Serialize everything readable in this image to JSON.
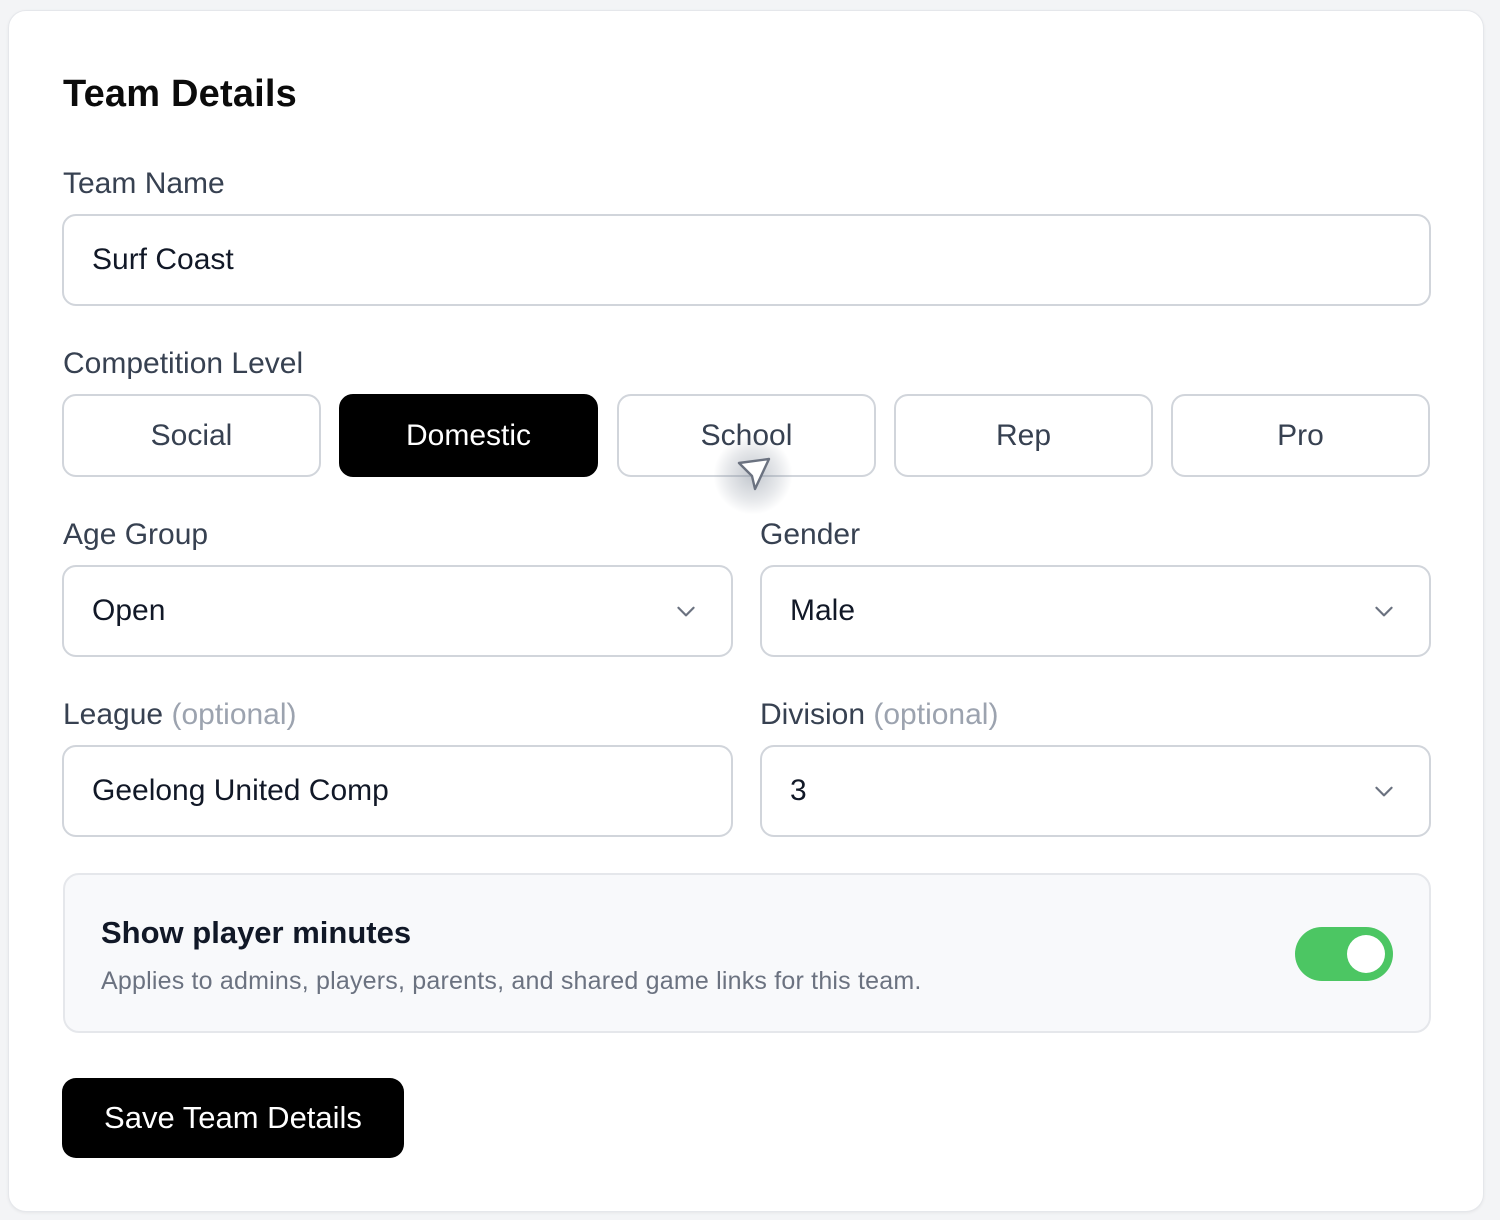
{
  "form": {
    "title": "Team Details",
    "team_name": {
      "label": "Team Name",
      "value": "Surf Coast"
    },
    "competition_level": {
      "label": "Competition Level",
      "options": [
        "Social",
        "Domestic",
        "School",
        "Rep",
        "Pro"
      ],
      "selected": "Domestic"
    },
    "age_group": {
      "label": "Age Group",
      "value": "Open"
    },
    "gender": {
      "label": "Gender",
      "value": "Male"
    },
    "league": {
      "label": "League",
      "optional_text": "(optional)",
      "value": "Geelong United Comp"
    },
    "division": {
      "label": "Division",
      "optional_text": "(optional)",
      "value": "3"
    },
    "player_minutes": {
      "title": "Show player minutes",
      "description": "Applies to admins, players, parents, and shared game links for this team.",
      "enabled": true
    },
    "save_label": "Save Team Details"
  },
  "colors": {
    "accent": "#000000",
    "toggle_on": "#4cc663",
    "border": "#d1d5db",
    "muted_text": "#9ca3af"
  },
  "icons": {
    "select_caret": "chevron-down-icon",
    "pointer": "cursor-arrow-icon"
  }
}
